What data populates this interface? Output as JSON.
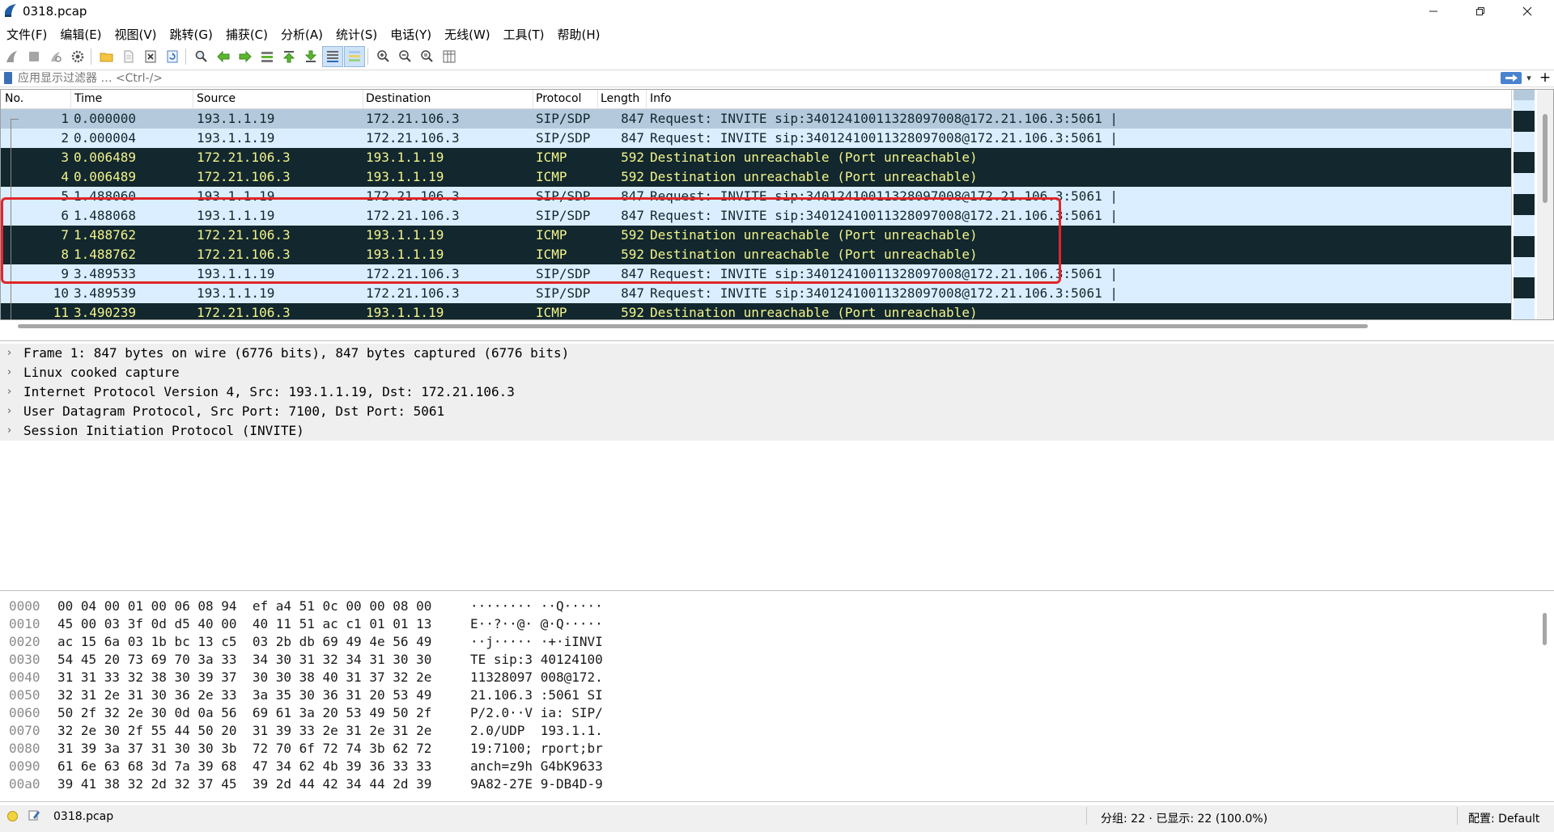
{
  "window": {
    "title": "0318.pcap"
  },
  "menu": [
    "文件(F)",
    "编辑(E)",
    "视图(V)",
    "跳转(G)",
    "捕获(C)",
    "分析(A)",
    "统计(S)",
    "电话(Y)",
    "无线(W)",
    "工具(T)",
    "帮助(H)"
  ],
  "toolbar": {
    "icons": [
      "shark-fin-start-icon",
      "stop-capture-icon",
      "restart-capture-icon",
      "capture-options-icon",
      "open-file-icon",
      "save-file-icon",
      "close-file-icon",
      "reload-file-icon",
      "find-packet-icon",
      "go-back-icon",
      "go-forward-icon",
      "go-to-packet-icon",
      "go-first-icon",
      "go-last-icon",
      "autoscroll-icon",
      "colorize-icon",
      "zoom-in-icon",
      "zoom-out-icon",
      "zoom-normal-icon",
      "resize-columns-icon"
    ]
  },
  "filter": {
    "placeholder": "应用显示过滤器 … <Ctrl-/>"
  },
  "packet_list": {
    "columns": [
      "No.",
      "Time",
      "Source",
      "Destination",
      "Protocol",
      "Length",
      "Info"
    ],
    "rows": [
      {
        "no": "1",
        "time": "0.000000",
        "src": "193.1.1.19",
        "dst": "172.21.106.3",
        "proto": "SIP/SDP",
        "len": "847",
        "info": "Request: INVITE sip:34012410011328097008@172.21.106.3:5061 |",
        "kind": "selected"
      },
      {
        "no": "2",
        "time": "0.000004",
        "src": "193.1.1.19",
        "dst": "172.21.106.3",
        "proto": "SIP/SDP",
        "len": "847",
        "info": "Request: INVITE sip:34012410011328097008@172.21.106.3:5061 |",
        "kind": "sip"
      },
      {
        "no": "3",
        "time": "0.006489",
        "src": "172.21.106.3",
        "dst": "193.1.1.19",
        "proto": "ICMP",
        "len": "592",
        "info": "Destination unreachable (Port unreachable)",
        "kind": "icmp"
      },
      {
        "no": "4",
        "time": "0.006489",
        "src": "172.21.106.3",
        "dst": "193.1.1.19",
        "proto": "ICMP",
        "len": "592",
        "info": "Destination unreachable (Port unreachable)",
        "kind": "icmp"
      },
      {
        "no": "5",
        "time": "1.488060",
        "src": "193.1.1.19",
        "dst": "172.21.106.3",
        "proto": "SIP/SDP",
        "len": "847",
        "info": "Request: INVITE sip:34012410011328097008@172.21.106.3:5061 |",
        "kind": "sip"
      },
      {
        "no": "6",
        "time": "1.488068",
        "src": "193.1.1.19",
        "dst": "172.21.106.3",
        "proto": "SIP/SDP",
        "len": "847",
        "info": "Request: INVITE sip:34012410011328097008@172.21.106.3:5061 |",
        "kind": "sip"
      },
      {
        "no": "7",
        "time": "1.488762",
        "src": "172.21.106.3",
        "dst": "193.1.1.19",
        "proto": "ICMP",
        "len": "592",
        "info": "Destination unreachable (Port unreachable)",
        "kind": "icmp"
      },
      {
        "no": "8",
        "time": "1.488762",
        "src": "172.21.106.3",
        "dst": "193.1.1.19",
        "proto": "ICMP",
        "len": "592",
        "info": "Destination unreachable (Port unreachable)",
        "kind": "icmp"
      },
      {
        "no": "9",
        "time": "3.489533",
        "src": "193.1.1.19",
        "dst": "172.21.106.3",
        "proto": "SIP/SDP",
        "len": "847",
        "info": "Request: INVITE sip:34012410011328097008@172.21.106.3:5061 |",
        "kind": "sip"
      },
      {
        "no": "10",
        "time": "3.489539",
        "src": "193.1.1.19",
        "dst": "172.21.106.3",
        "proto": "SIP/SDP",
        "len": "847",
        "info": "Request: INVITE sip:34012410011328097008@172.21.106.3:5061 |",
        "kind": "sip"
      },
      {
        "no": "11",
        "time": "3.490239",
        "src": "172.21.106.3",
        "dst": "193.1.1.19",
        "proto": "ICMP",
        "len": "592",
        "info": "Destination unreachable (Port unreachable)",
        "kind": "icmp"
      }
    ],
    "colors": {
      "sip_bg": "#dbeeff",
      "icmp_bg": "#12272e",
      "icmp_fg": "#f3f48b",
      "selected_bg": "#b4c9dc",
      "highlight_border": "#e0262b"
    }
  },
  "details": [
    "Frame 1: 847 bytes on wire (6776 bits), 847 bytes captured (6776 bits)",
    "Linux cooked capture",
    "Internet Protocol Version 4, Src: 193.1.1.19, Dst: 172.21.106.3",
    "User Datagram Protocol, Src Port: 7100, Dst Port: 5061",
    "Session Initiation Protocol (INVITE)"
  ],
  "bytes": [
    {
      "off": "0000",
      "hex": "00 04 00 01 00 06 08 94  ef a4 51 0c 00 00 08 00",
      "ascii": "········ ··Q·····"
    },
    {
      "off": "0010",
      "hex": "45 00 03 3f 0d d5 40 00  40 11 51 ac c1 01 01 13",
      "ascii": "E··?··@· @·Q·····"
    },
    {
      "off": "0020",
      "hex": "ac 15 6a 03 1b bc 13 c5  03 2b db 69 49 4e 56 49",
      "ascii": "··j····· ·+·iINVI"
    },
    {
      "off": "0030",
      "hex": "54 45 20 73 69 70 3a 33  34 30 31 32 34 31 30 30",
      "ascii": "TE sip:3 40124100"
    },
    {
      "off": "0040",
      "hex": "31 31 33 32 38 30 39 37  30 30 38 40 31 37 32 2e",
      "ascii": "11328097 008@172."
    },
    {
      "off": "0050",
      "hex": "32 31 2e 31 30 36 2e 33  3a 35 30 36 31 20 53 49",
      "ascii": "21.106.3 :5061 SI"
    },
    {
      "off": "0060",
      "hex": "50 2f 32 2e 30 0d 0a 56  69 61 3a 20 53 49 50 2f",
      "ascii": "P/2.0··V ia: SIP/"
    },
    {
      "off": "0070",
      "hex": "32 2e 30 2f 55 44 50 20  31 39 33 2e 31 2e 31 2e",
      "ascii": "2.0/UDP  193.1.1."
    },
    {
      "off": "0080",
      "hex": "31 39 3a 37 31 30 30 3b  72 70 6f 72 74 3b 62 72",
      "ascii": "19:7100; rport;br"
    },
    {
      "off": "0090",
      "hex": "61 6e 63 68 3d 7a 39 68  47 34 62 4b 39 36 33 33",
      "ascii": "anch=z9h G4bK9633"
    },
    {
      "off": "00a0",
      "hex": "39 41 38 32 2d 32 37 45  39 2d 44 42 34 44 2d 39",
      "ascii": "9A82-27E 9-DB4D-9"
    }
  ],
  "status": {
    "file": "0318.pcap",
    "counts": "分组: 22 · 已显示: 22 (100.0%)",
    "profile": "配置: Default"
  }
}
